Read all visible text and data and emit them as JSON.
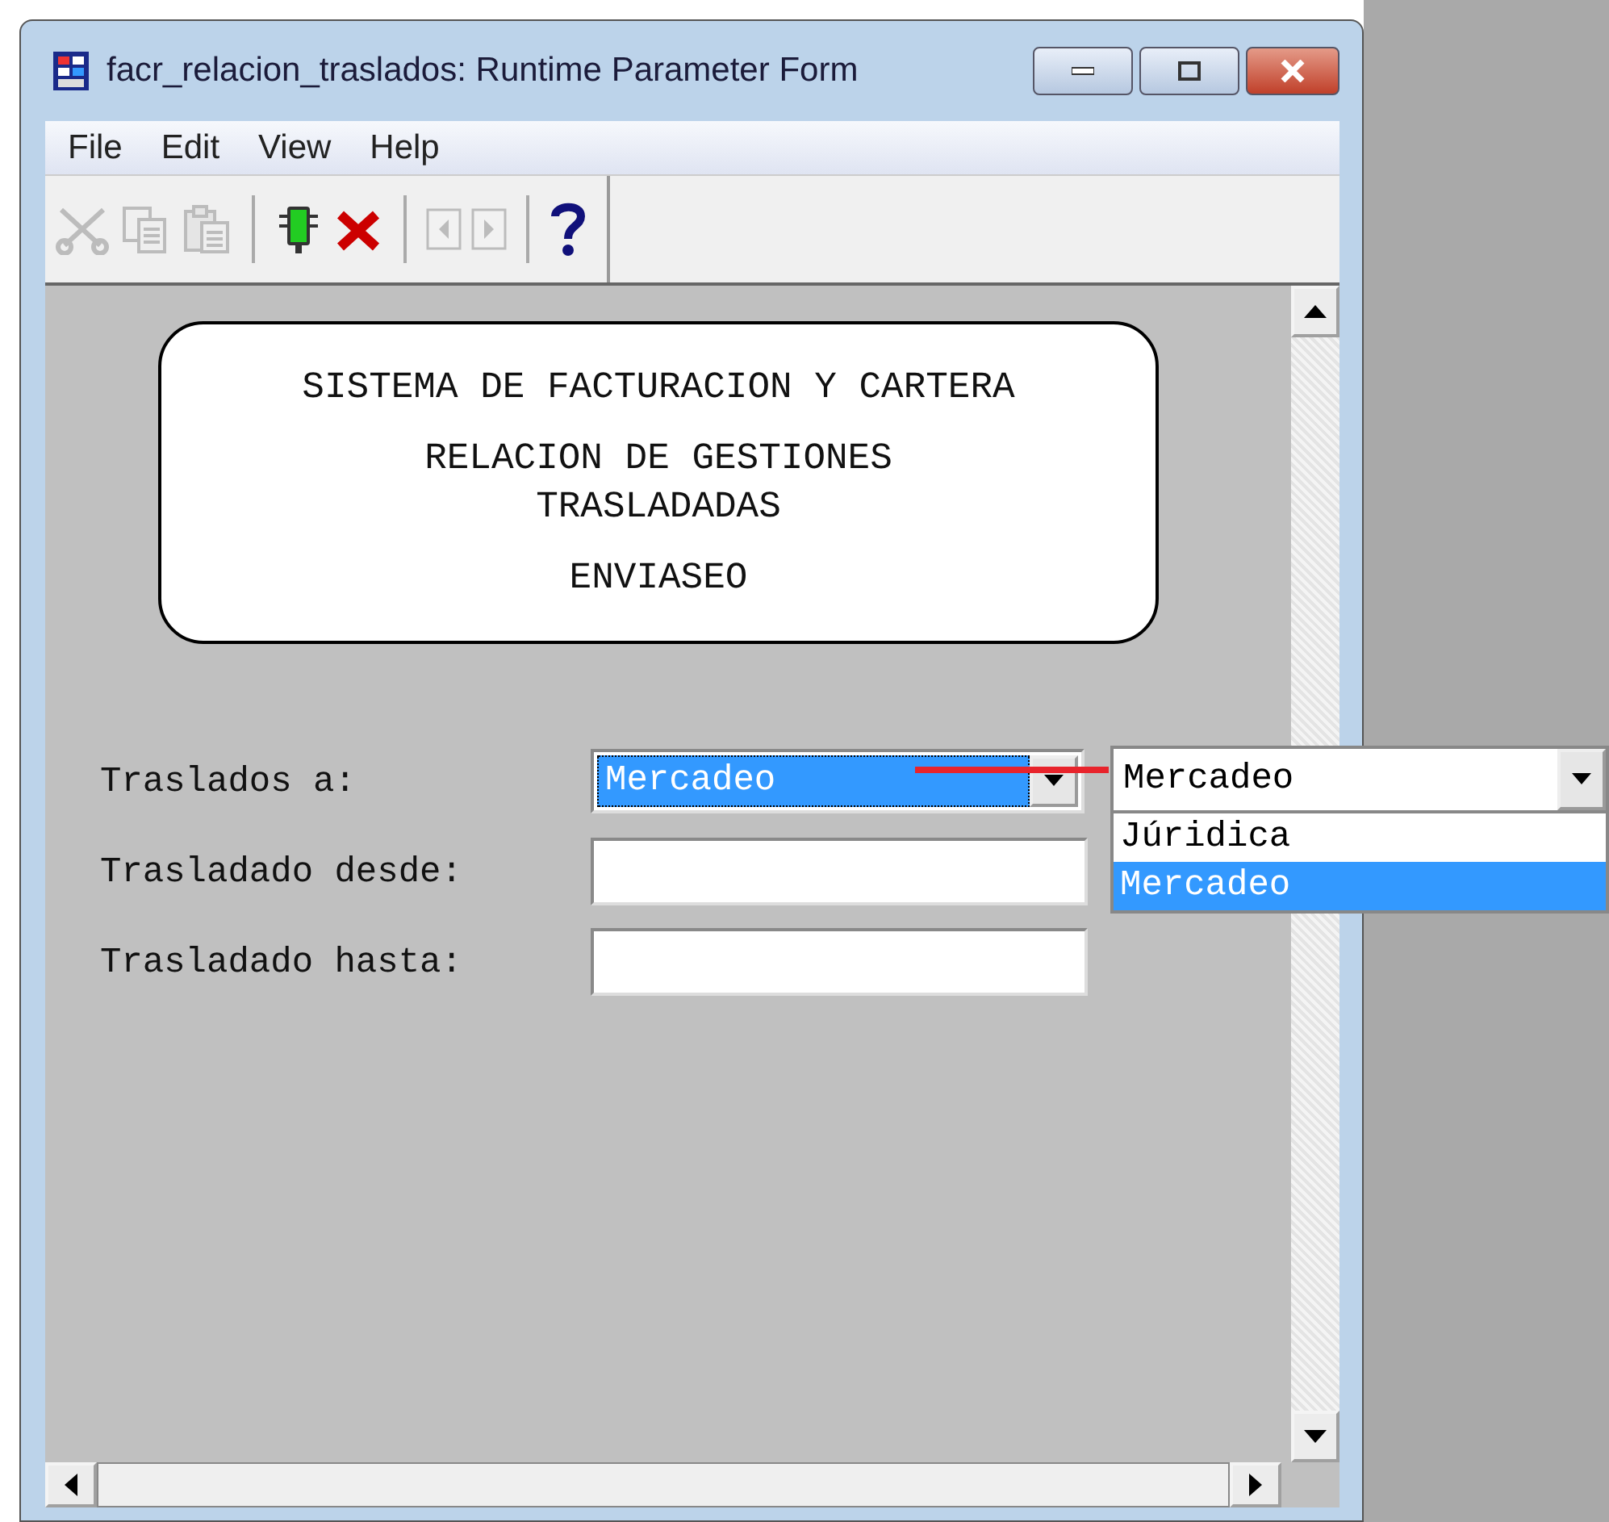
{
  "window": {
    "title": "facr_relacion_traslados: Runtime Parameter Form"
  },
  "menu": [
    "File",
    "Edit",
    "View",
    "Help"
  ],
  "toolbar": [
    {
      "kind": "cut",
      "disabled": true
    },
    {
      "kind": "copy",
      "disabled": true
    },
    {
      "kind": "paste",
      "disabled": true
    },
    {
      "kind": "separator"
    },
    {
      "kind": "run",
      "disabled": false
    },
    {
      "kind": "cancel",
      "disabled": false
    },
    {
      "kind": "separator"
    },
    {
      "kind": "prev",
      "disabled": true
    },
    {
      "kind": "next",
      "disabled": true
    },
    {
      "kind": "separator"
    },
    {
      "kind": "help",
      "disabled": false
    }
  ],
  "header": [
    [
      "SISTEMA DE FACTURACION Y CARTERA"
    ],
    [
      "RELACION DE GESTIONES",
      "TRASLADADAS"
    ],
    [
      "ENVIASEO"
    ]
  ],
  "fields": [
    {
      "label": "Traslados a:",
      "kind": "dropdown",
      "value": "Mercadeo",
      "selected": true
    },
    {
      "label": "Trasladado desde:",
      "kind": "text"
    },
    {
      "label": "Trasladado hasta:",
      "kind": "text"
    }
  ],
  "popup": {
    "value": "Mercadeo",
    "options": [
      {
        "label": "Júridica",
        "selected": false
      },
      {
        "label": "Mercadeo",
        "selected": true
      }
    ]
  }
}
